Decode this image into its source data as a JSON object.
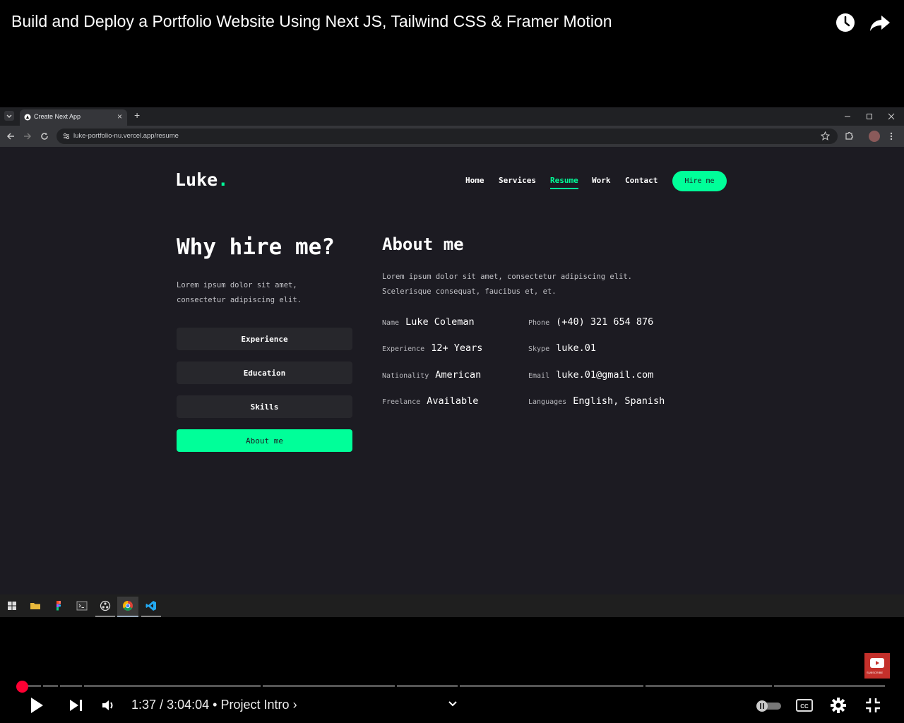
{
  "video": {
    "title": "Build and Deploy a Portfolio Website Using Next JS, Tailwind CSS & Framer Motion",
    "time_current": "1:37",
    "time_total": "3:04:04",
    "time_separator": "/",
    "chapter_bullet": "•",
    "chapter": "Project Intro",
    "chapter_arrow": "›",
    "progress_fraction": 0.009,
    "subscribe_label": "SUBSCRIBE"
  },
  "browser": {
    "tab_title": "Create Next App",
    "new_tab_symbol": "+",
    "tab_close_symbol": "×",
    "url": "luke-portfolio-nu.vercel.app/resume"
  },
  "site": {
    "logo_text": "Luke",
    "logo_dot": ".",
    "nav": [
      "Home",
      "Services",
      "Resume",
      "Work",
      "Contact"
    ],
    "active_nav": "Resume",
    "hire_button": "Hire me",
    "why_title": "Why hire me?",
    "why_desc": "Lorem ipsum dolor sit amet, consectetur adipiscing elit.",
    "side_buttons": [
      "Experience",
      "Education",
      "Skills",
      "About me"
    ],
    "active_side": "About me",
    "about_title": "About me",
    "about_desc": "Lorem ipsum dolor sit amet, consectetur adipiscing elit. Scelerisque consequat, faucibus et, et.",
    "info": [
      {
        "label": "Name",
        "value": "Luke Coleman"
      },
      {
        "label": "Phone",
        "value": "(+40) 321 654 876"
      },
      {
        "label": "Experience",
        "value": "12+ Years"
      },
      {
        "label": "Skype",
        "value": "luke.01"
      },
      {
        "label": "Nationality",
        "value": "American"
      },
      {
        "label": "Email",
        "value": "luke.01@gmail.com"
      },
      {
        "label": "Freelance",
        "value": "Available"
      },
      {
        "label": "Languages",
        "value": "English, Spanish"
      }
    ]
  },
  "colors": {
    "accent": "#00ff99",
    "page_bg": "#1c1b22",
    "button_bg": "#27272c",
    "yt_red": "#ff0033"
  },
  "icons": {
    "yt_top": [
      "clock-icon",
      "share-icon"
    ],
    "browser": [
      "back-icon",
      "forward-icon",
      "reload-icon",
      "site-info-icon",
      "bookmark-star-icon",
      "extensions-icon",
      "profile-icon",
      "menu-icon"
    ],
    "taskbar": [
      "windows-start-icon",
      "file-explorer-icon",
      "figma-icon",
      "terminal-icon",
      "obs-icon",
      "chrome-icon",
      "vscode-icon"
    ],
    "player": [
      "play-icon",
      "next-icon",
      "volume-icon",
      "chevron-down-icon",
      "autoplay-toggle-icon",
      "captions-icon",
      "settings-icon",
      "exit-fullscreen-icon"
    ]
  }
}
